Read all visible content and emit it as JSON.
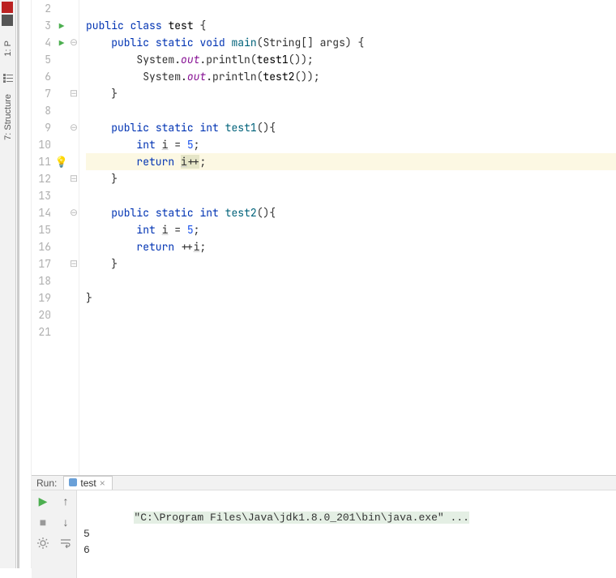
{
  "sidebar": {
    "project_label": "1: P",
    "structure_label": "7: Structure"
  },
  "editor": {
    "lines": [
      {
        "n": 2,
        "marker": "",
        "fold": "",
        "html": ""
      },
      {
        "n": 3,
        "marker": "run",
        "fold": "",
        "html": "<span class='kw'>public</span> <span class='kw'>class</span> <span class='cls'>test</span> {"
      },
      {
        "n": 4,
        "marker": "run",
        "fold": "open",
        "html": "    <span class='kw'>public</span> <span class='kw'>static</span> <span class='type'>void</span> <span class='mname'>main</span>(String[] args) {"
      },
      {
        "n": 5,
        "marker": "",
        "fold": "",
        "html": "        System.<span class='field'>out</span>.println(<span class='ident'>test1</span>());"
      },
      {
        "n": 6,
        "marker": "",
        "fold": "",
        "html": "         System.<span class='field'>out</span>.println(<span class='ident'>test2</span>());"
      },
      {
        "n": 7,
        "marker": "",
        "fold": "close",
        "html": "    }"
      },
      {
        "n": 8,
        "marker": "",
        "fold": "",
        "html": ""
      },
      {
        "n": 9,
        "marker": "",
        "fold": "open",
        "html": "    <span class='kw'>public</span> <span class='kw'>static</span> <span class='type'>int</span> <span class='mname'>test1</span>(){"
      },
      {
        "n": 10,
        "marker": "",
        "fold": "",
        "html": "        <span class='type'>int</span> <span class='underlined'>i</span> = <span class='num'>5</span>;"
      },
      {
        "n": 11,
        "marker": "bulb",
        "fold": "",
        "html": "        <span class='kw'>return</span> <span class='warn-bg'><span class='underlined'>i</span>++</span>;",
        "hl": true
      },
      {
        "n": 12,
        "marker": "",
        "fold": "close",
        "html": "    }"
      },
      {
        "n": 13,
        "marker": "",
        "fold": "",
        "html": ""
      },
      {
        "n": 14,
        "marker": "",
        "fold": "open",
        "html": "    <span class='kw'>public</span> <span class='kw'>static</span> <span class='type'>int</span> <span class='mname'>test2</span>(){"
      },
      {
        "n": 15,
        "marker": "",
        "fold": "",
        "html": "        <span class='type'>int</span> <span class='underlined'>i</span> = <span class='num'>5</span>;"
      },
      {
        "n": 16,
        "marker": "",
        "fold": "",
        "html": "        <span class='kw'>return</span> ++<span class='underlined'>i</span>;"
      },
      {
        "n": 17,
        "marker": "",
        "fold": "close",
        "html": "    }"
      },
      {
        "n": 18,
        "marker": "",
        "fold": "",
        "html": ""
      },
      {
        "n": 19,
        "marker": "",
        "fold": "",
        "html": "}"
      },
      {
        "n": 20,
        "marker": "",
        "fold": "",
        "html": ""
      },
      {
        "n": 21,
        "marker": "",
        "fold": "",
        "html": ""
      }
    ]
  },
  "run": {
    "label": "Run:",
    "tab_name": "test",
    "output": {
      "cmd": "\"C:\\Program Files\\Java\\jdk1.8.0_201\\bin\\java.exe\" ...",
      "lines": [
        "5",
        "6"
      ]
    }
  }
}
